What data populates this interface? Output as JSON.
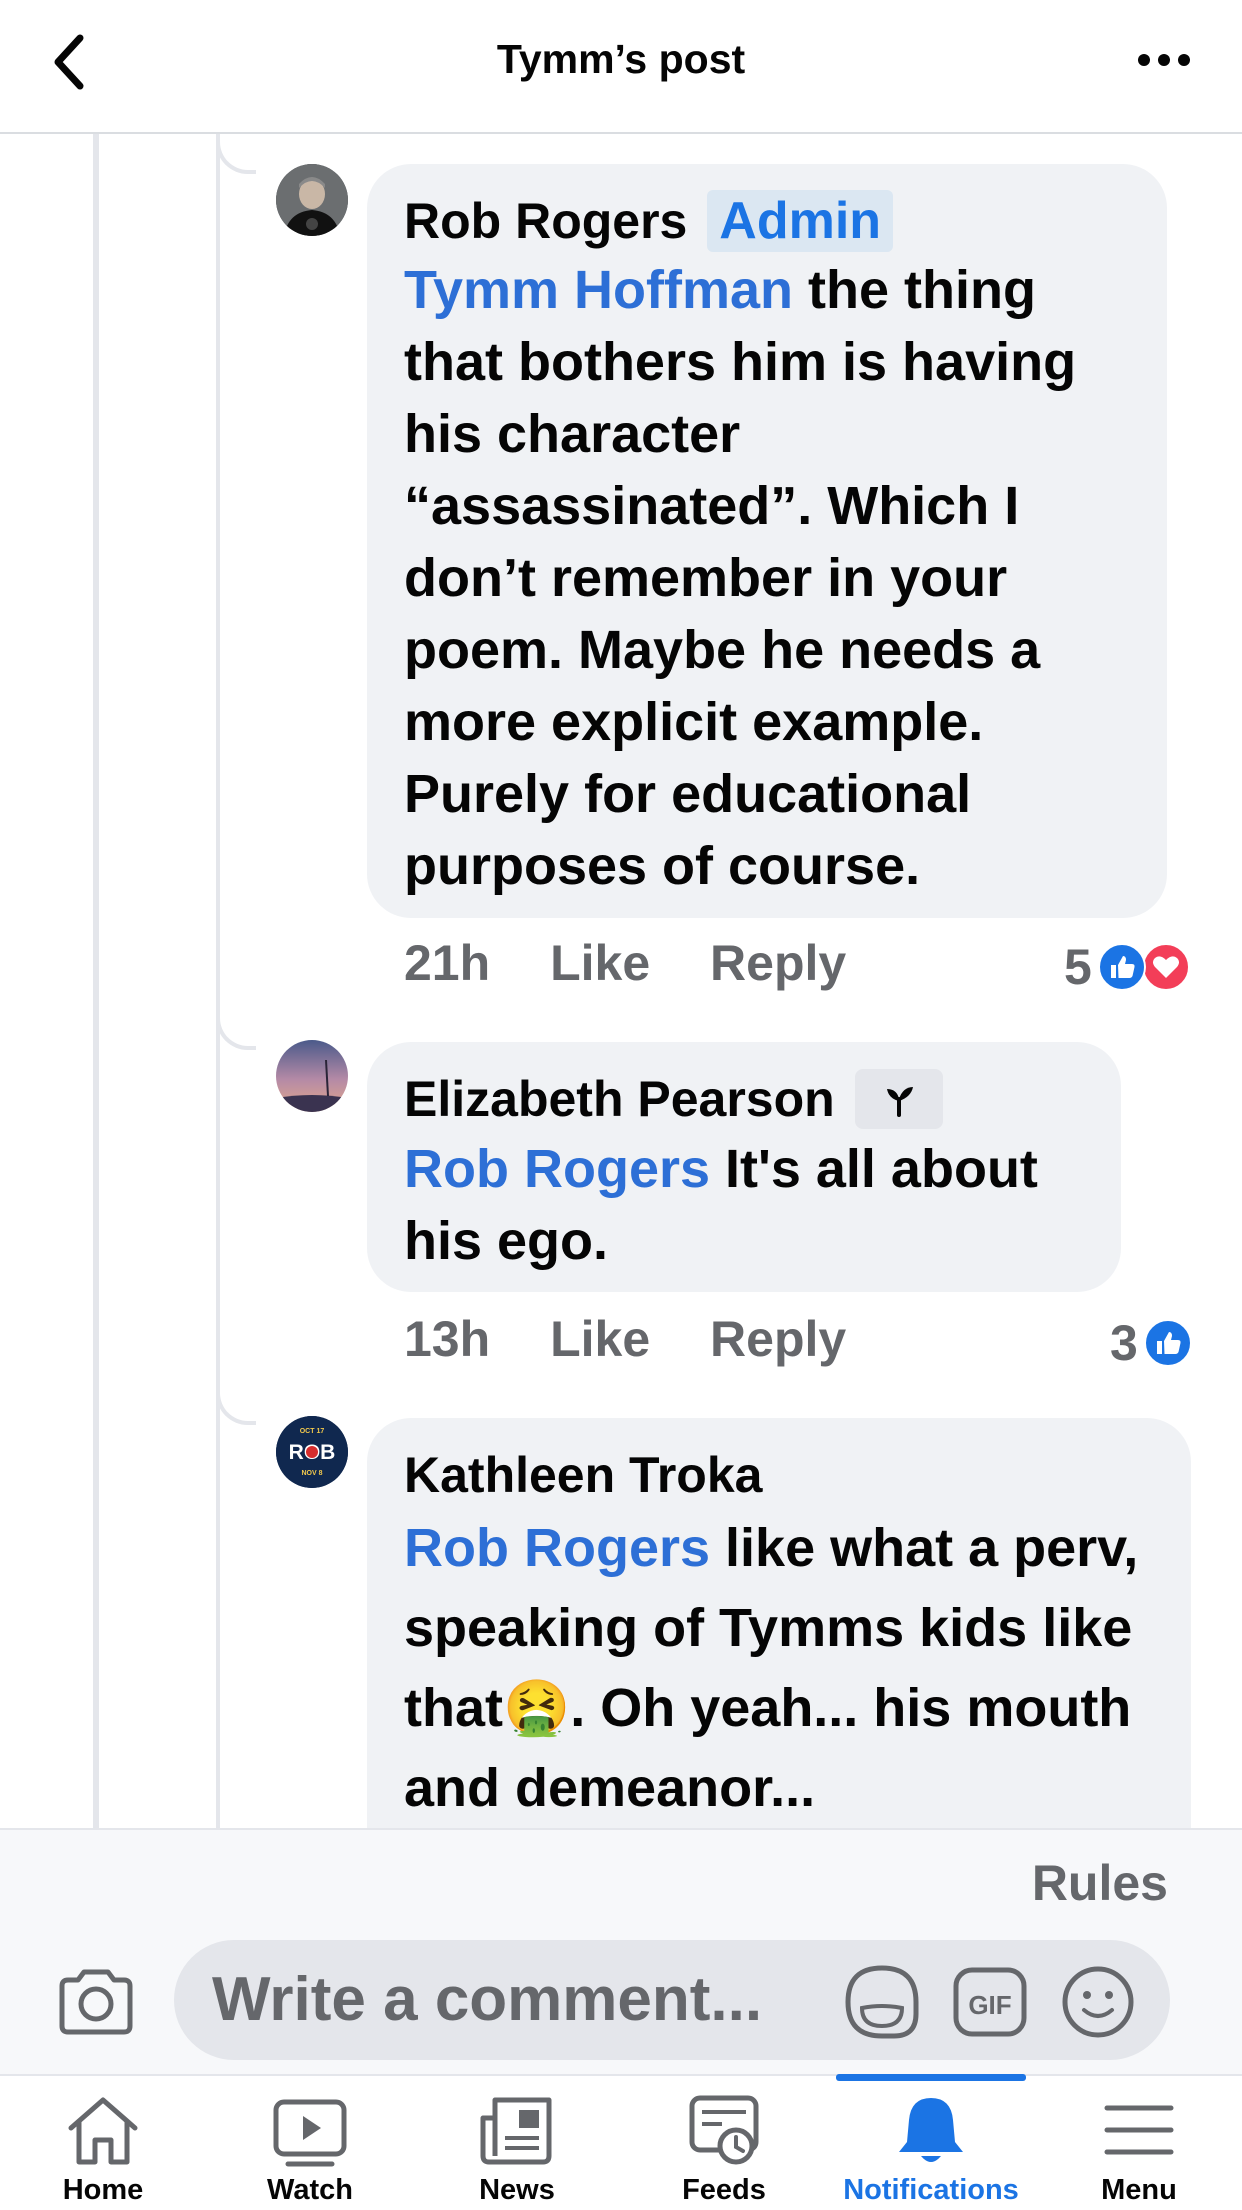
{
  "header": {
    "title": "Tymm’s post"
  },
  "comments": [
    {
      "author": "Rob Rogers",
      "badge": "Admin",
      "mention": "Tymm Hoffman",
      "text": " the thing that bothers him is having his character “assassinated”. Which I don’t remember in your poem. Maybe he needs a more explicit example. Purely for educational purposes of course.",
      "time": "21h",
      "like_label": "Like",
      "reply_label": "Reply",
      "reaction_count": "5",
      "reactions": [
        "like",
        "love"
      ]
    },
    {
      "author": "Elizabeth Pearson",
      "badge_icon": "sprout-icon",
      "mention": "Rob Rogers",
      "text": " It's all about his ego.",
      "time": "13h",
      "like_label": "Like",
      "reply_label": "Reply",
      "reaction_count": "3",
      "reactions": [
        "like"
      ]
    },
    {
      "author": "Kathleen Troka",
      "mention": "Rob Rogers",
      "text": " like what a perv, speaking of Tymms kids like that🤮.  Oh yeah... his mouth and demeanor...",
      "avatar_text": "ROB",
      "avatar_top": "OCT 17",
      "avatar_bottom": "NOV 8"
    }
  ],
  "composer": {
    "rules_label": "Rules",
    "placeholder": "Write a comment..."
  },
  "nav": {
    "tabs": [
      {
        "label": "Home",
        "icon": "home-icon"
      },
      {
        "label": "Watch",
        "icon": "watch-icon"
      },
      {
        "label": "News",
        "icon": "news-icon"
      },
      {
        "label": "Feeds",
        "icon": "feeds-icon"
      },
      {
        "label": "Notifications",
        "icon": "bell-icon",
        "active": true
      },
      {
        "label": "Menu",
        "icon": "menu-icon"
      }
    ]
  },
  "colors": {
    "accent": "#1b74e4",
    "mention": "#2d6fd6",
    "bubble": "#f0f2f5",
    "secondary_text": "#65676b",
    "love": "#f33e58"
  }
}
